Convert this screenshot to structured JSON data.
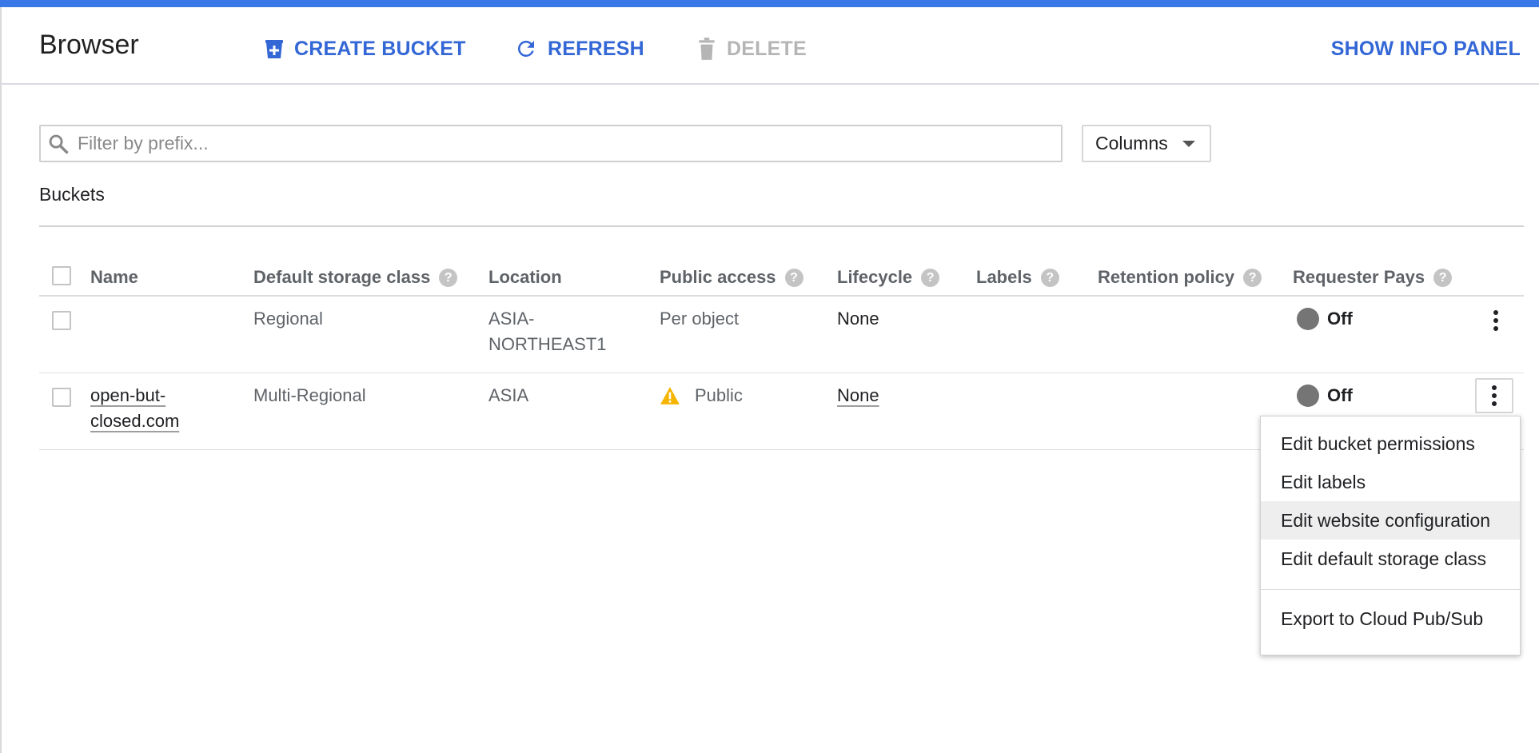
{
  "header": {
    "title": "Browser",
    "create_label": "CREATE BUCKET",
    "refresh_label": "REFRESH",
    "delete_label": "DELETE",
    "info_label": "SHOW INFO PANEL"
  },
  "filter": {
    "placeholder": "Filter by prefix...",
    "value": ""
  },
  "columns_button": {
    "label": "Columns"
  },
  "section": {
    "label": "Buckets"
  },
  "table": {
    "headers": {
      "name": "Name",
      "storage_class": "Default storage class",
      "location": "Location",
      "public_access": "Public access",
      "lifecycle": "Lifecycle",
      "labels": "Labels",
      "retention": "Retention policy",
      "requester_pays": "Requester Pays"
    },
    "rows": [
      {
        "name": "",
        "storage_class": "Regional",
        "location": "ASIA-NORTHEAST1",
        "public_access": "Per object",
        "lifecycle": "None",
        "labels": "",
        "retention": "",
        "requester_pays": "Off"
      },
      {
        "name": "open-but-closed.com",
        "storage_class": "Multi-Regional",
        "location": "ASIA",
        "public_access": "Public",
        "lifecycle": "None",
        "labels": "",
        "retention": "",
        "requester_pays": "Off"
      }
    ]
  },
  "menu": {
    "items": [
      "Edit bucket permissions",
      "Edit labels",
      "Edit website configuration",
      "Edit default storage class",
      "Export to Cloud Pub/Sub"
    ],
    "highlighted": "Edit website configuration"
  },
  "colors": {
    "accent": "#3b78e7",
    "link_blue": "#3367d6",
    "disabled": "#b5b5b5",
    "warning": "#f4b400",
    "off_dot": "#757575"
  },
  "icons": {
    "create": "bucket-add-icon",
    "refresh": "refresh-icon",
    "delete": "trash-icon",
    "search": "search-icon",
    "help": "help-icon",
    "warning": "warning-icon",
    "more": "more-vert-icon",
    "dropdown": "caret-down-icon"
  }
}
